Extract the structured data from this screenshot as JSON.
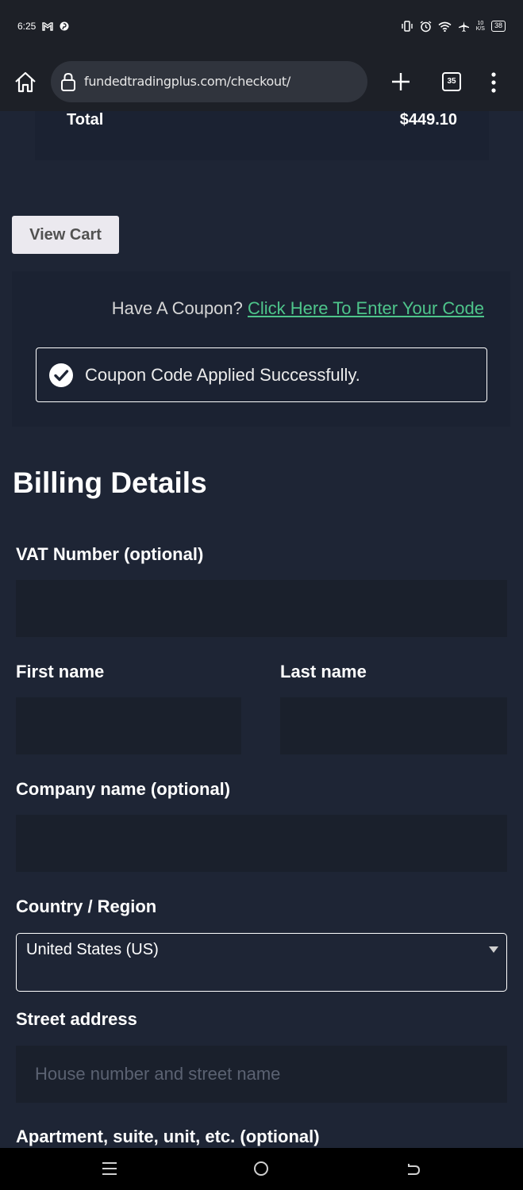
{
  "status_bar": {
    "time": "6:25",
    "speed_top": "10",
    "speed_unit": "K/S",
    "battery": "38"
  },
  "browser": {
    "url": "fundedtradingplus.com/checkout/",
    "tab_count": "35"
  },
  "order": {
    "total_label": "Total",
    "total_value": "$449.10"
  },
  "cart": {
    "view_cart_label": "View Cart"
  },
  "coupon": {
    "prompt": "Have A Coupon?",
    "link": "Click Here To Enter Your Code",
    "success_message": "Coupon Code Applied Successfully."
  },
  "billing": {
    "title": "Billing Details",
    "vat_label": "VAT Number (optional)",
    "first_name_label": "First name",
    "last_name_label": "Last name",
    "company_label": "Company name (optional)",
    "country_label": "Country / Region",
    "country_value": "United States (US)",
    "street_label": "Street address",
    "street_placeholder": "House number and street name",
    "apartment_label": "Apartment, suite, unit, etc. (optional)"
  },
  "colors": {
    "page_bg": "#1e2535",
    "link": "#4ec58b",
    "button_bg": "#ebe9ef"
  }
}
